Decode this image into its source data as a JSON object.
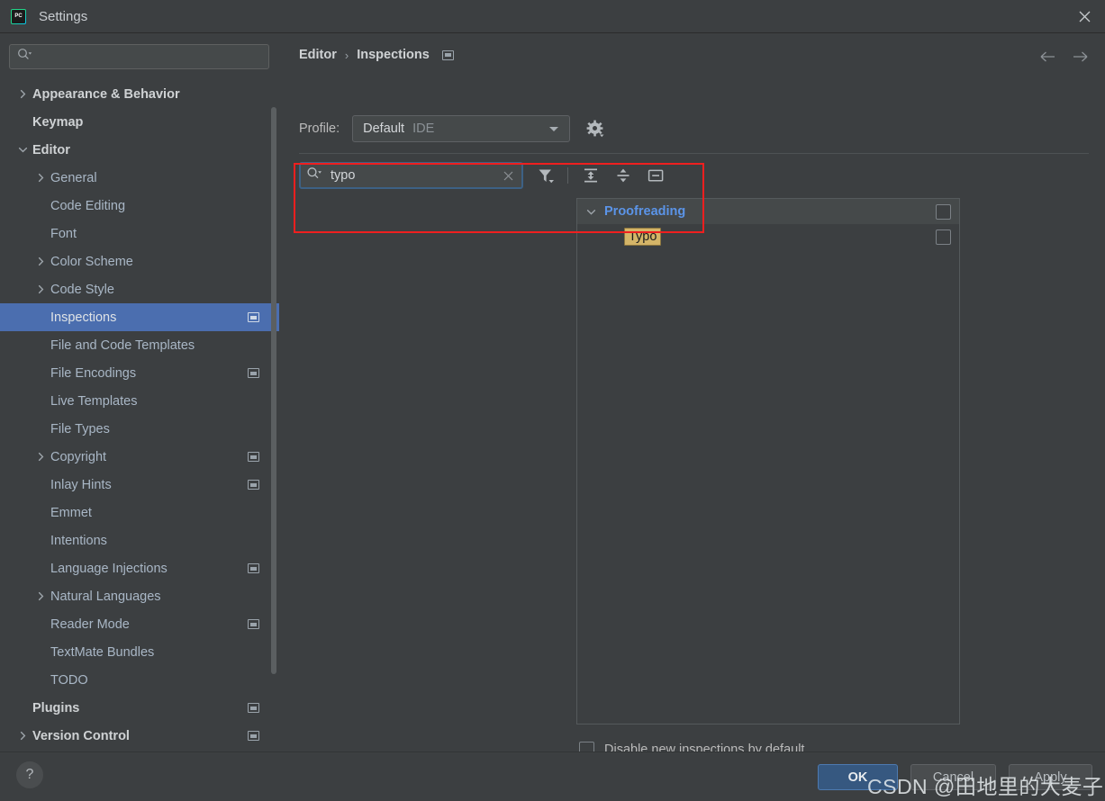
{
  "window": {
    "title": "Settings",
    "logo_icon": "pycharm-logo-icon",
    "close_icon": "close-icon"
  },
  "sidebar": {
    "search": {
      "placeholder": "",
      "value": "",
      "icon": "search-icon"
    },
    "items": [
      {
        "label": "Appearance & Behavior",
        "level": 0,
        "arrow": "chevron-right",
        "badge": false,
        "selected": false
      },
      {
        "label": "Keymap",
        "level": 0,
        "arrow": "",
        "badge": false,
        "selected": false
      },
      {
        "label": "Editor",
        "level": 0,
        "arrow": "chevron-down",
        "badge": false,
        "selected": false
      },
      {
        "label": "General",
        "level": 1,
        "arrow": "chevron-right",
        "badge": false,
        "selected": false
      },
      {
        "label": "Code Editing",
        "level": 1,
        "arrow": "",
        "badge": false,
        "selected": false
      },
      {
        "label": "Font",
        "level": 1,
        "arrow": "",
        "badge": false,
        "selected": false
      },
      {
        "label": "Color Scheme",
        "level": 1,
        "arrow": "chevron-right",
        "badge": false,
        "selected": false
      },
      {
        "label": "Code Style",
        "level": 1,
        "arrow": "chevron-right",
        "badge": false,
        "selected": false
      },
      {
        "label": "Inspections",
        "level": 1,
        "arrow": "",
        "badge": true,
        "selected": true
      },
      {
        "label": "File and Code Templates",
        "level": 1,
        "arrow": "",
        "badge": false,
        "selected": false
      },
      {
        "label": "File Encodings",
        "level": 1,
        "arrow": "",
        "badge": true,
        "selected": false
      },
      {
        "label": "Live Templates",
        "level": 1,
        "arrow": "",
        "badge": false,
        "selected": false
      },
      {
        "label": "File Types",
        "level": 1,
        "arrow": "",
        "badge": false,
        "selected": false
      },
      {
        "label": "Copyright",
        "level": 1,
        "arrow": "chevron-right",
        "badge": true,
        "selected": false
      },
      {
        "label": "Inlay Hints",
        "level": 1,
        "arrow": "",
        "badge": true,
        "selected": false
      },
      {
        "label": "Emmet",
        "level": 1,
        "arrow": "",
        "badge": false,
        "selected": false
      },
      {
        "label": "Intentions",
        "level": 1,
        "arrow": "",
        "badge": false,
        "selected": false
      },
      {
        "label": "Language Injections",
        "level": 1,
        "arrow": "",
        "badge": true,
        "selected": false
      },
      {
        "label": "Natural Languages",
        "level": 1,
        "arrow": "chevron-right",
        "badge": false,
        "selected": false
      },
      {
        "label": "Reader Mode",
        "level": 1,
        "arrow": "",
        "badge": true,
        "selected": false
      },
      {
        "label": "TextMate Bundles",
        "level": 1,
        "arrow": "",
        "badge": false,
        "selected": false
      },
      {
        "label": "TODO",
        "level": 1,
        "arrow": "",
        "badge": false,
        "selected": false
      },
      {
        "label": "Plugins",
        "level": 0,
        "arrow": "",
        "badge": true,
        "selected": false
      },
      {
        "label": "Version Control",
        "level": 0,
        "arrow": "chevron-right",
        "badge": true,
        "selected": false
      }
    ]
  },
  "main": {
    "breadcrumb": {
      "parent": "Editor",
      "separator": "›",
      "current": "Inspections",
      "badge_icon": "project-scope-badge-icon"
    },
    "nav": {
      "back_icon": "arrow-left-icon",
      "forward_icon": "arrow-right-icon"
    },
    "profile": {
      "label": "Profile:",
      "value": "Default",
      "scope": "IDE",
      "dropdown_icon": "chevron-down-icon",
      "gear_icon": "gear-icon"
    },
    "search": {
      "value": "typo",
      "placeholder": "",
      "search_icon": "search-icon",
      "clear_icon": "clear-icon"
    },
    "toolbar": [
      {
        "name": "filter-icon",
        "title": "Filter"
      },
      {
        "name": "expand-all-icon",
        "title": "Expand All"
      },
      {
        "name": "collapse-all-icon",
        "title": "Collapse All"
      },
      {
        "name": "reset-icon",
        "title": "Reset"
      }
    ],
    "inspections": [
      {
        "name": "Proofreading",
        "type": "group",
        "checked": false,
        "expanded": true,
        "highlighted": false
      },
      {
        "name": "Typo",
        "type": "item",
        "checked": false,
        "expanded": false,
        "highlighted": true
      }
    ],
    "disable_new": {
      "label": "Disable new inspections by default",
      "checked": false
    }
  },
  "bottom": {
    "help_label": "?",
    "ok_label": "OK",
    "cancel_label": "Cancel",
    "apply_label": "Apply"
  },
  "watermark": {
    "text": "CSDN @田地里的大麦子"
  },
  "colors": {
    "window_bg": "#3c3f41",
    "selection_blue": "#4b6eaf",
    "accent_link": "#5b94e8",
    "highlight_gold": "#d4b568",
    "annotation_red": "#ef1f1f",
    "primary_button": "#365880"
  }
}
